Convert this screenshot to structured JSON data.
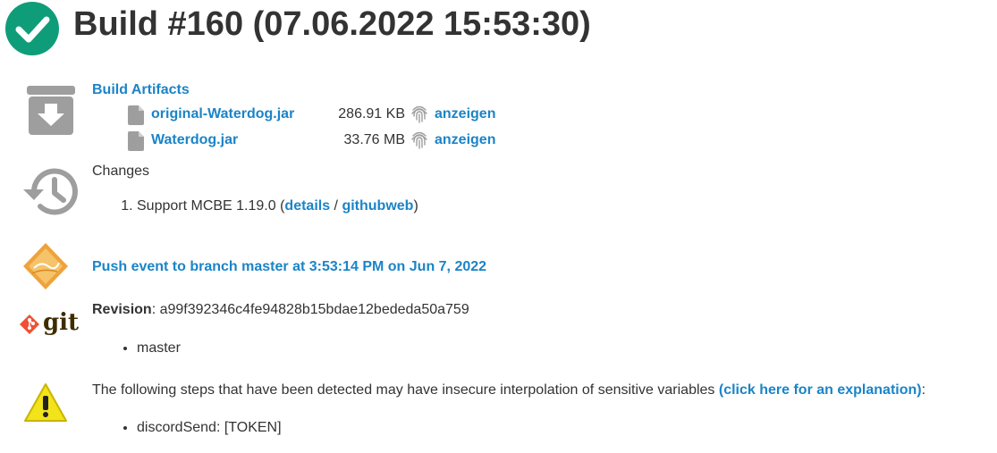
{
  "page_title": "Build #160 (07.06.2022 15:53:30)",
  "artifacts": {
    "heading": "Build Artifacts",
    "items": [
      {
        "name": "original-Waterdog.jar",
        "size": "286.91 KB",
        "view": "anzeigen"
      },
      {
        "name": "Waterdog.jar",
        "size": "33.76 MB",
        "view": "anzeigen"
      }
    ]
  },
  "changes": {
    "heading": "Changes",
    "item_prefix": "Support MCBE 1.19.0 (",
    "details_link": "details",
    "separator": " / ",
    "githubweb_link": "githubweb",
    "item_suffix": ")"
  },
  "trigger": {
    "link": "Push event to branch master at 3:53:14 PM on Jun 7, 2022"
  },
  "git": {
    "logo_text": "git",
    "revision_label": "Revision",
    "revision_value": ": a99f392346c4fe94828b15bdae12bededa50a759",
    "branches": [
      "master"
    ]
  },
  "warning": {
    "text": "The following steps that have been detected may have insecure interpolation of sensitive variables ",
    "link": "(click here for an explanation)",
    "suffix": ":",
    "steps": [
      "discordSend: [TOKEN]"
    ]
  },
  "colors": {
    "success": "#0f9d79",
    "link": "#1b84c7",
    "text": "#333333",
    "icon_gray": "#9e9e9e",
    "warning_yellow": "#f2e31a",
    "git_orange": "#f05033"
  }
}
